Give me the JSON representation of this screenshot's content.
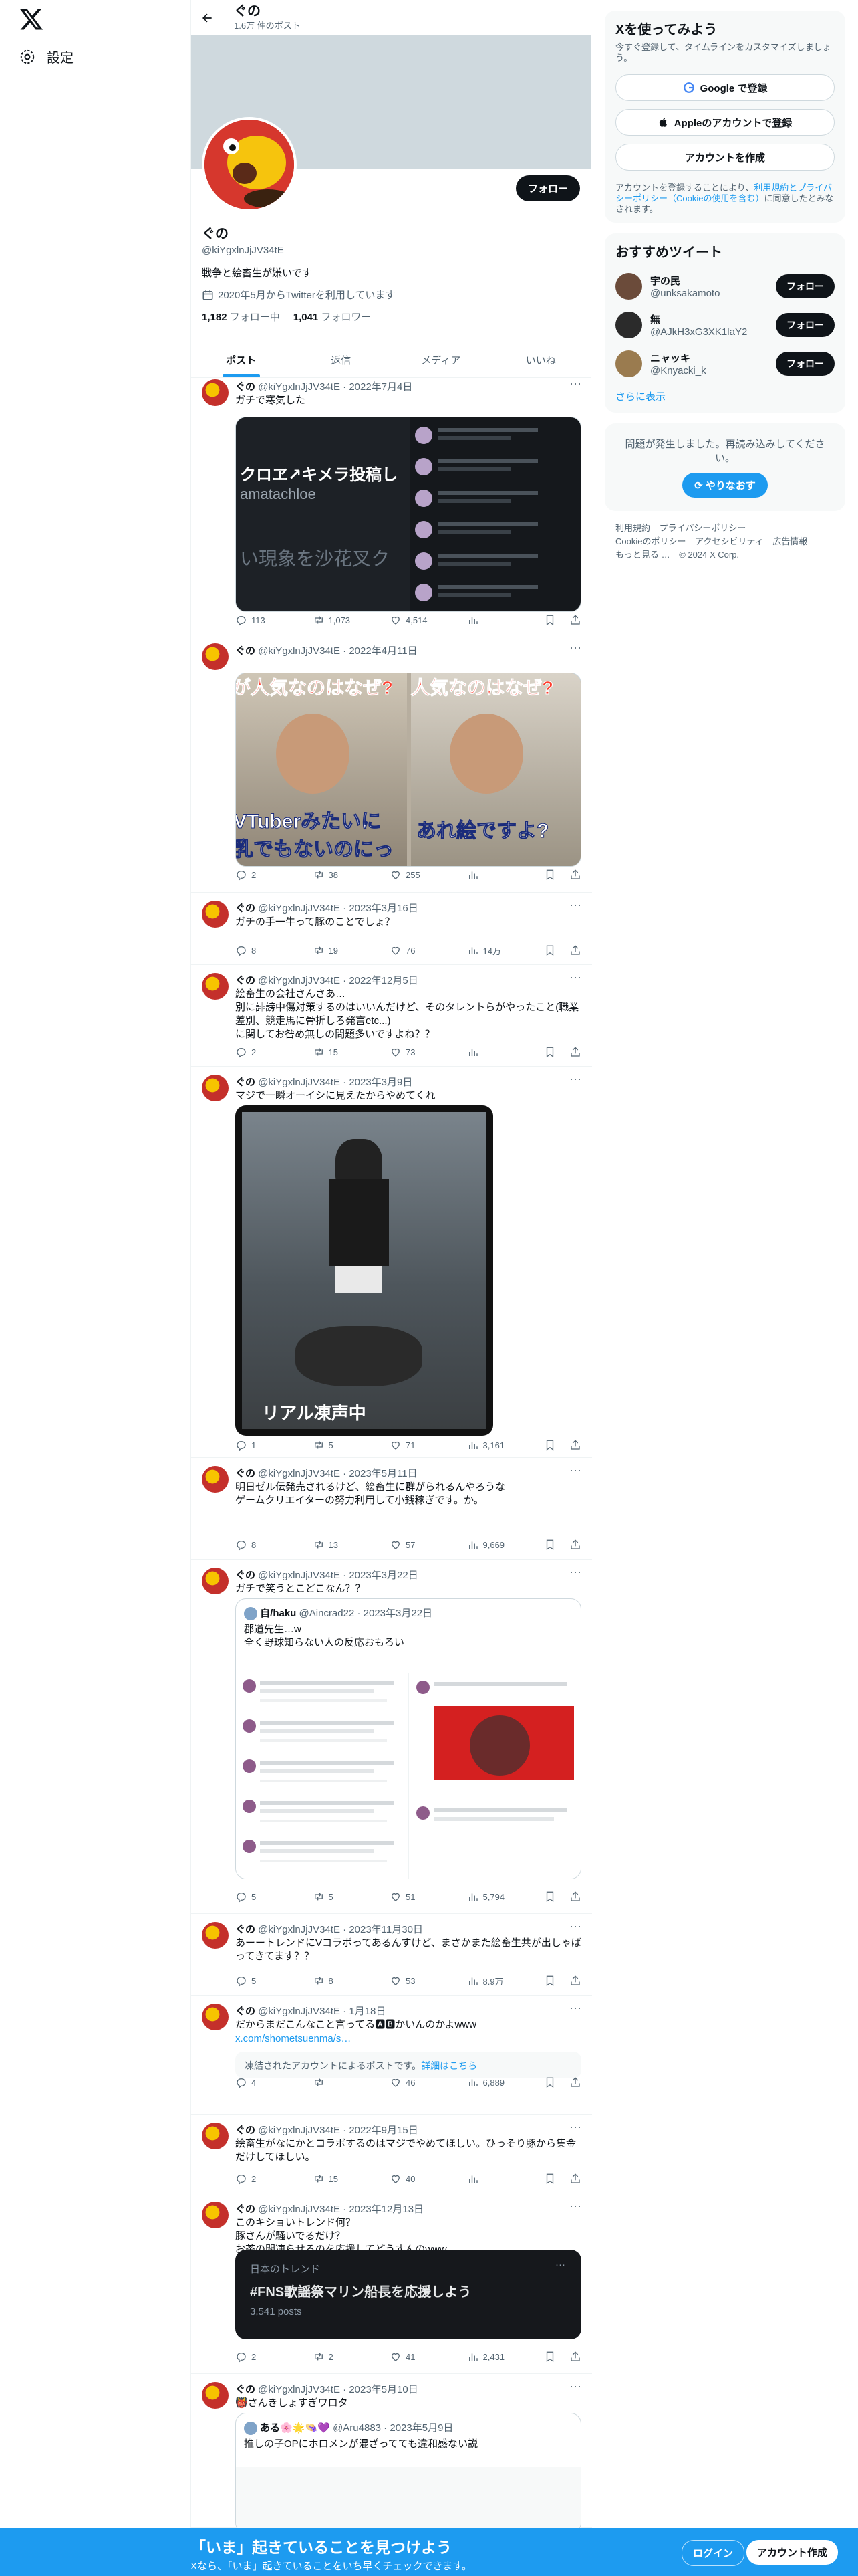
{
  "nav": {
    "settings_label": "設定"
  },
  "header": {
    "title": "ぐの",
    "subtitle": "1.6万 件のポスト"
  },
  "profile": {
    "name": "ぐの",
    "handle": "@kiYgxlnJjJV34tE",
    "bio": "戦争と絵畜生が嫌いです",
    "joined": "2020年5月からTwitterを利用しています",
    "following_count": "1,182",
    "following_label": "フォロー中",
    "followers_count": "1,041",
    "followers_label": "フォロワー",
    "follow_button": "フォロー"
  },
  "tabs": [
    "ポスト",
    "返信",
    "メディア",
    "いいね"
  ],
  "tweets": [
    {
      "name": "ぐの",
      "handle": "@kiYgxlnJjJV34tE",
      "date": "2022年7月4日",
      "text": "ガチで寒気した",
      "reply": "113",
      "rt": "1,073",
      "like": "4,514",
      "views": "",
      "media_text1": "クロヱ↗キメラ投稿し",
      "media_text2": "amatachloe",
      "media_text3": "い現象を沙花叉ク"
    },
    {
      "name": "ぐの",
      "handle": "@kiYgxlnJjJV34tE",
      "date": "2022年4月11日",
      "text": "",
      "reply": "2",
      "rt": "38",
      "like": "255",
      "views": "",
      "media_cap_top1": "が人気なのはなぜ?",
      "media_cap_top2": "人気なのはなぜ?",
      "media_cap_bot1": "VTuberみたいに",
      "media_cap_bot1b": "乳でもないのにっ",
      "media_cap_bot2": "あれ絵ですよ?"
    },
    {
      "name": "ぐの",
      "handle": "@kiYgxlnJjJV34tE",
      "date": "2023年3月16日",
      "text": "ガチの手一牛って豚のことでしょ？",
      "reply": "8",
      "rt": "19",
      "like": "76",
      "views": "14万"
    },
    {
      "name": "ぐの",
      "handle": "@kiYgxlnJjJV34tE",
      "date": "2022年12月5日",
      "text": "絵畜生の会社さんさあ…\n別に誹謗中傷対策するのはいいんだけど、そのタレントらがやったこと(職業差別、競走馬に骨折しろ発言etc...)\nに関してお咎め無しの問題多いですよね？？",
      "reply": "2",
      "rt": "15",
      "like": "73",
      "views": ""
    },
    {
      "name": "ぐの",
      "handle": "@kiYgxlnJjJV34tE",
      "date": "2023年3月9日",
      "text": "マジで一瞬オーイシに見えたからやめてくれ",
      "reply": "1",
      "rt": "5",
      "like": "71",
      "views": "3,161",
      "media_caption": "リアル凍声中"
    },
    {
      "name": "ぐの",
      "handle": "@kiYgxlnJjJV34tE",
      "date": "2023年5月11日",
      "text": "明日ゼル伝発売されるけど、絵畜生に群がられるんやろうな\nゲームクリエイターの努力利用して小銭稼ぎです。か。",
      "reply": "8",
      "rt": "13",
      "like": "57",
      "views": "9,669"
    },
    {
      "name": "ぐの",
      "handle": "@kiYgxlnJjJV34tE",
      "date": "2023年3月22日",
      "text": "ガチで笑うとこどこなん？？",
      "reply": "5",
      "rt": "5",
      "like": "51",
      "views": "5,794",
      "quote_name": "自/haku",
      "quote_handle": "@Aincrad22",
      "quote_date": "2023年3月22日",
      "quote_text": "郡道先生…w\n全く野球知らない人の反応おもろい"
    },
    {
      "name": "ぐの",
      "handle": "@kiYgxlnJjJV34tE",
      "date": "2023年11月30日",
      "text": "あーートレンドにVコラボってあるんすけど、まさかまた絵畜生共が出しゃばってきてます？？",
      "reply": "5",
      "rt": "8",
      "like": "53",
      "views": "8.9万"
    },
    {
      "name": "ぐの",
      "handle": "@kiYgxlnJjJV34tE",
      "date": "1月18日",
      "text": "だからまだこんなこと言ってる🅰🅱かいんのかよwww",
      "link": "x.com/shometsuenma/s…",
      "notice": "凍結されたアカウントによるポストです。",
      "notice_link": "詳細はこちら",
      "reply": "4",
      "rt": "",
      "like": "46",
      "views": "6,889"
    },
    {
      "name": "ぐの",
      "handle": "@kiYgxlnJjJV34tE",
      "date": "2022年9月15日",
      "text": "絵畜生がなにかとコラボするのはマジでやめてほしい。ひっそり豚から集金だけしてほしい。",
      "reply": "2",
      "rt": "15",
      "like": "40",
      "views": ""
    },
    {
      "name": "ぐの",
      "handle": "@kiYgxlnJjJV34tE",
      "date": "2023年12月13日",
      "text": "このキショいトレンド何？\n豚さんが騒いでるだけ？\nお茶の間凍らせるのを応援してどうすんのwww",
      "reply": "2",
      "rt": "2",
      "like": "41",
      "views": "2,431",
      "trend_label": "日本のトレンド",
      "trend_title": "#FNS歌謡祭マリン船長を応援しよう",
      "trend_count": "3,541 posts"
    },
    {
      "name": "ぐの",
      "handle": "@kiYgxlnJjJV34tE",
      "date": "2023年5月10日",
      "text": "👹さんきしょすぎワロタ",
      "quote_name": "ある🌸🌟👒💜",
      "quote_handle": "@Aru4883",
      "quote_date": "2023年5月9日",
      "quote_text": "推しの子OPにホロメンが混ざってても違和感ない説"
    }
  ],
  "sidebar": {
    "signup_title": "Xを使ってみよう",
    "signup_sub": "今すぐ登録して、タイムラインをカスタマイズしましょう。",
    "google_btn": "Google で登録",
    "apple_btn": "Appleのアカウントで登録",
    "create_btn": "アカウントを作成",
    "terms_pre": "アカウントを登録することにより、",
    "terms_link": "利用規約とプライバシーポリシー（Cookieの使用を含む）",
    "terms_post": "に同意したとみなされます。",
    "rec_title": "おすすめツイート",
    "rec_users": [
      {
        "name": "宇の民",
        "handle": "@unksakamoto",
        "btn": "フォロー"
      },
      {
        "name": "無",
        "handle": "@AJkH3xG3XK1laY2",
        "btn": "フォロー"
      },
      {
        "name": "ニャッキ",
        "handle": "@Knyacki_k",
        "btn": "フォロー"
      }
    ],
    "show_more": "さらに表示",
    "error_text": "問題が発生しました。再読み込みしてください。",
    "retry_btn": "やりなおす",
    "footer_links": [
      "利用規約",
      "プライバシーポリシー",
      "Cookieのポリシー",
      "アクセシビリティ",
      "広告情報",
      "もっと見る …",
      "© 2024 X Corp."
    ]
  },
  "bottom_bar": {
    "title": "「いま」起きていることを見つけよう",
    "sub": "Xなら、「いま」起きていることをいち早くチェックできます。",
    "login": "ログイン",
    "signup": "アカウント作成"
  },
  "colors": {
    "accent": "#1d9bf0",
    "text": "#0f1419",
    "muted": "#536471"
  }
}
